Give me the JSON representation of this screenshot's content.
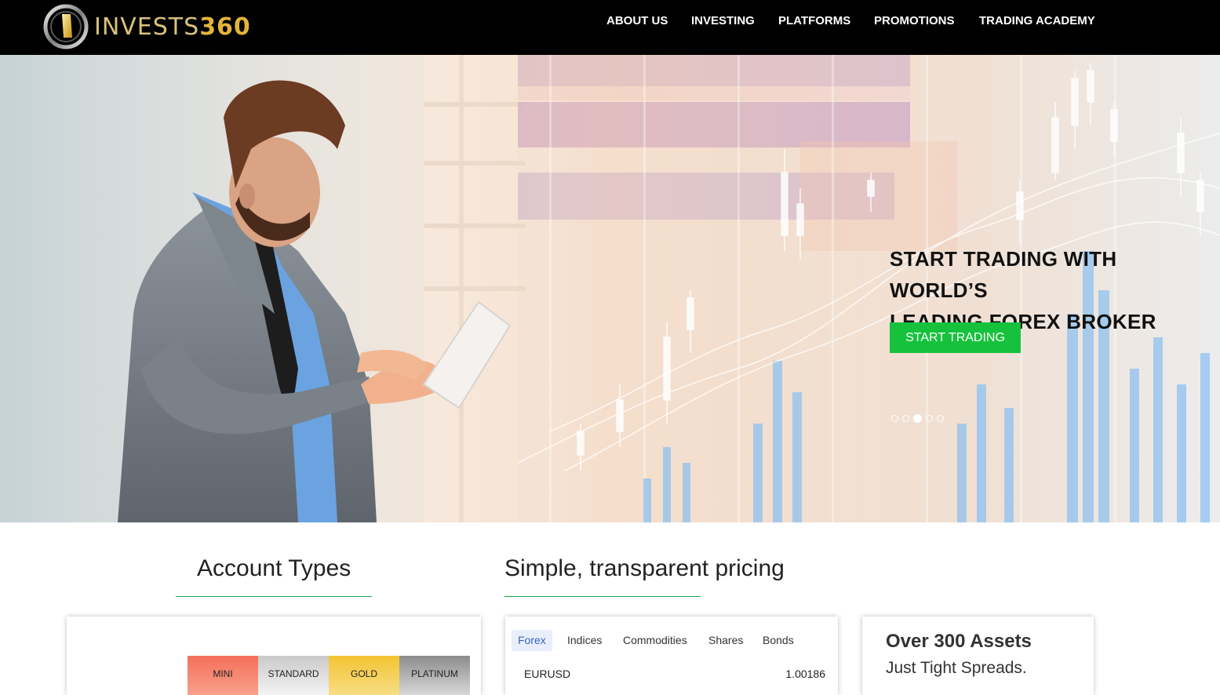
{
  "header": {
    "logo_text": "INVESTS",
    "logo_num": "360",
    "nav": [
      {
        "label": "ABOUT US"
      },
      {
        "label": "INVESTING"
      },
      {
        "label": "PLATFORMS"
      },
      {
        "label": "PROMOTIONS"
      },
      {
        "label": "TRADING ACADEMY"
      }
    ]
  },
  "hero": {
    "headline_line1": "START TRADING WITH WORLD’S",
    "headline_line2": "LEADING FOREX BROKER",
    "cta_label": "START TRADING",
    "slide_count": 5,
    "active_slide": 3
  },
  "sections": {
    "accounts_title": "Account Types",
    "pricing_title": "Simple, transparent pricing"
  },
  "account_types": [
    {
      "label": "MINI",
      "color": "#f4705a"
    },
    {
      "label": "STANDARD",
      "color": "#d8d8d8"
    },
    {
      "label": "GOLD",
      "color": "#f3c332"
    },
    {
      "label": "PLATINUM",
      "color": "#9d9d9d"
    }
  ],
  "pricing": {
    "tabs": [
      "Forex",
      "Indices",
      "Commodities",
      "Shares",
      "Bonds"
    ],
    "active_tab": "Forex",
    "rows": [
      {
        "symbol": "EURUSD",
        "value": "1.00186"
      }
    ]
  },
  "assets": {
    "title": "Over 300 Assets",
    "subtitle": "Just Tight Spreads."
  },
  "colors": {
    "accent_green": "#16c23c",
    "rule_green": "#1aa54a",
    "gold": "#e2b53a",
    "active_tab_blue": "#3a63c7"
  }
}
